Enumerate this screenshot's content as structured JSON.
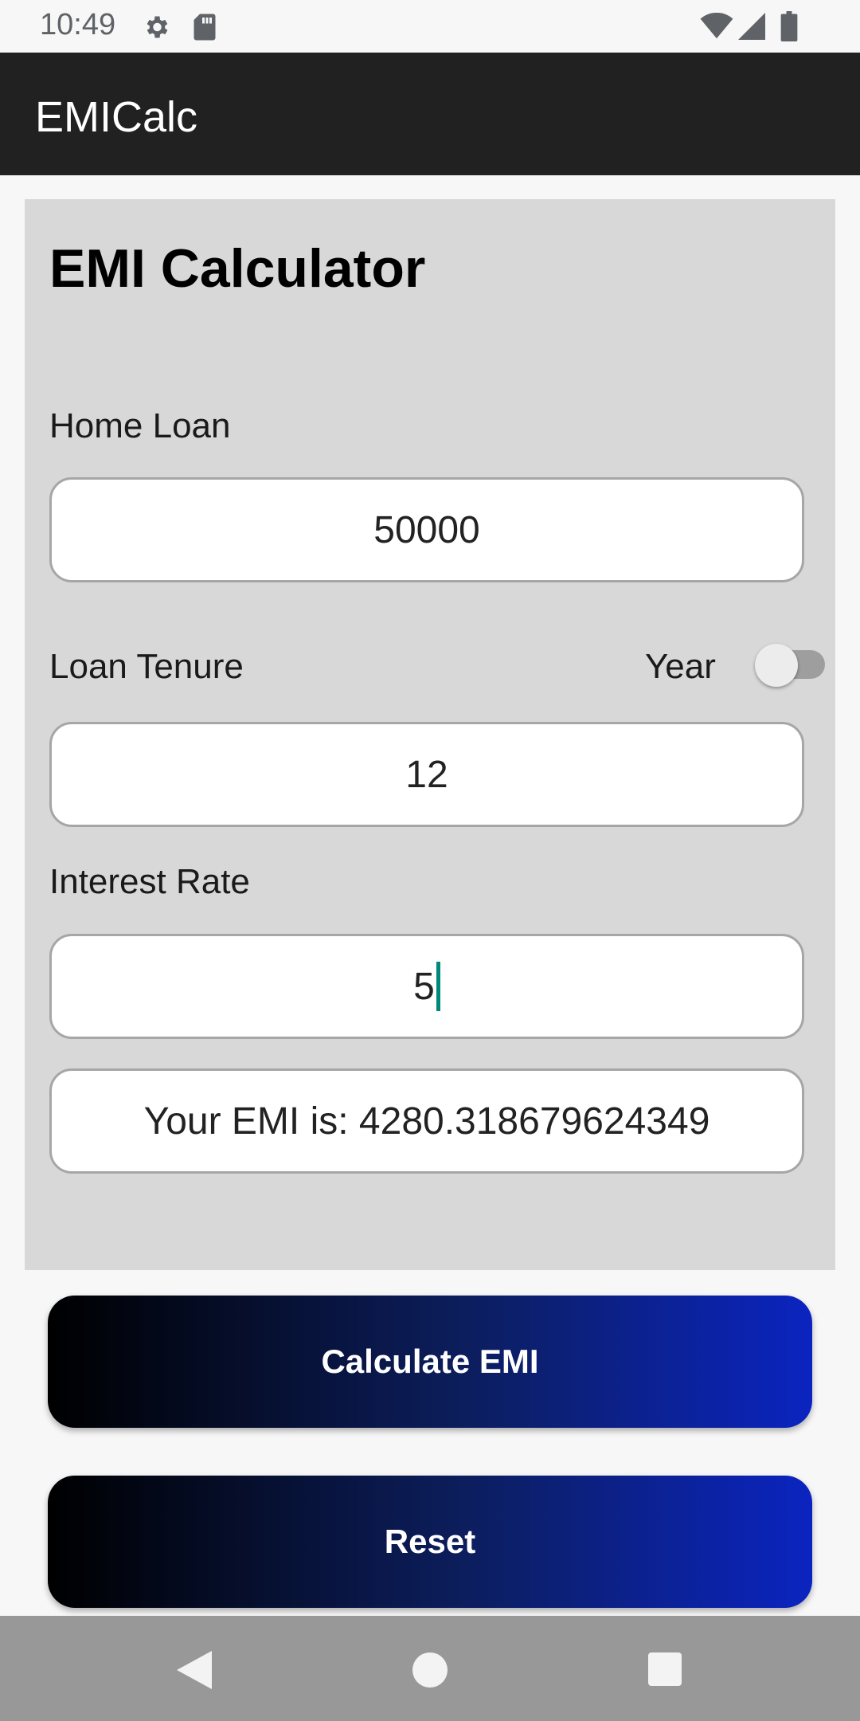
{
  "status_bar": {
    "time": "10:49",
    "icons": [
      "settings-icon",
      "sd-card-icon",
      "wifi-icon",
      "cell-signal-icon",
      "battery-icon"
    ]
  },
  "app_bar": {
    "title": "EMICalc"
  },
  "card": {
    "title": "EMI Calculator",
    "home_loan": {
      "label": "Home Loan",
      "value": "50000"
    },
    "loan_tenure": {
      "label": "Loan Tenure",
      "unit_label": "Year",
      "toggle_on": false,
      "value": "12"
    },
    "interest_rate": {
      "label": "Interest Rate",
      "value": "5"
    },
    "result": "Your EMI is: 4280.318679624349"
  },
  "buttons": {
    "calculate": "Calculate EMI",
    "reset": "Reset"
  },
  "colors": {
    "app_bar": "#212121",
    "card_bg": "#d8d8d8",
    "button_gradient_start": "#000000",
    "button_gradient_end": "#0b24c0",
    "caret": "#00897b"
  },
  "nav_bar": {
    "icons": [
      "back-icon",
      "home-icon",
      "recents-icon"
    ]
  }
}
